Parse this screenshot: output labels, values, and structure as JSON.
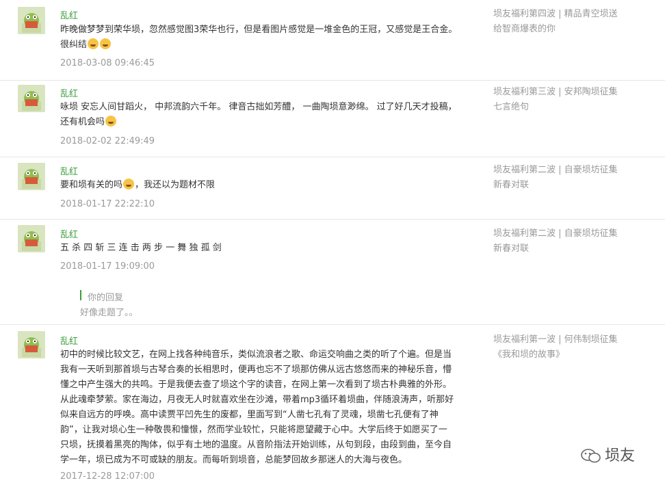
{
  "comments": [
    {
      "author": "乱红",
      "text": [
        "昨晚做梦梦到荣华埙，忽然感觉图3荣华也行，但是看图片感觉是一堆金色的王冠，又感觉是王合金。",
        "很纠结"
      ],
      "emojis_line2": 2,
      "date": "2018-03-08 09:46:45",
      "side": [
        "埙友福利第四波 | 精品青空埙送",
        "给智商爆表的你"
      ]
    },
    {
      "author": "乱红",
      "text": [
        "咏埙 安忘人间甘蹈火，  中邦流韵六千年。  律音古拙如芳醴，  一曲陶埙意渺绵。  过了好几天才投稿，",
        "还有机会吗"
      ],
      "emojis_line2": 1,
      "date": "2018-02-02 22:49:49",
      "side": [
        "埙友福利第三波 | 安邦陶埙征集",
        "七言绝句"
      ]
    },
    {
      "author": "乱红",
      "text_before": "要和埙有关的吗",
      "text_after": "，我还以为题材不限",
      "date": "2018-01-17 22:22:10",
      "side": [
        "埙友福利第二波 | 自豪埙坊征集",
        "新春对联"
      ]
    },
    {
      "author": "乱红",
      "text": [
        "五 杀 四 斩 三 连 击 两 步 一 舞 独 孤 剑"
      ],
      "date": "2018-01-17 19:09:00",
      "side": [
        "埙友福利第二波 | 自豪埙坊征集",
        "新春对联"
      ],
      "reply_label": "你的回复",
      "reply_text": "好像走题了。。"
    },
    {
      "author": "乱红",
      "text": [
        "初中的时候比较文艺，在网上找各种纯音乐，类似流浪者之歌、命运交响曲之类的听了个遍。但是当",
        "我有一天听到那首埙与古琴合奏的长相思时，便再也忘不了埙那仿佛从远古悠悠而来的神秘乐音，懵",
        "懂之中产生强大的共鸣。于是我便去查了埙这个字的读音，在网上第一次看到了埙古朴典雅的外形。",
        "从此魂牵梦萦。家在海边，月夜无人时就喜欢坐在沙滩，带着mp3循环着埙曲，伴随浪涛声，听那好",
        "似来自远方的呼唤。高中读贾平凹先生的废都，里面写到“人凿七孔有了灵魂，埙凿七孔便有了神",
        "韵”，让我对埙心生一种敬畏和憧憬，然而学业较忙，只能将愿望藏于心中。大学后终于如愿买了一",
        "只埙，抚摸着黑亮的陶体，似乎有土地的温度。从音阶指法开始训练，从句到段，由段到曲，至今自",
        "学一年，埙已成为不可或缺的朋友。而每听到埙音，总能梦回故乡那迷人的大海与夜色。"
      ],
      "date": "2017-12-28 12:07:00",
      "side": [
        "埙友福利第一波 | 何伟制埙征集",
        "《我和埙的故事》"
      ]
    }
  ],
  "watermark": "埙友",
  "colors": {
    "author": "#3c9d3c",
    "date": "#9a9a9a",
    "side": "#999999",
    "divider": "#e6e6e6"
  }
}
